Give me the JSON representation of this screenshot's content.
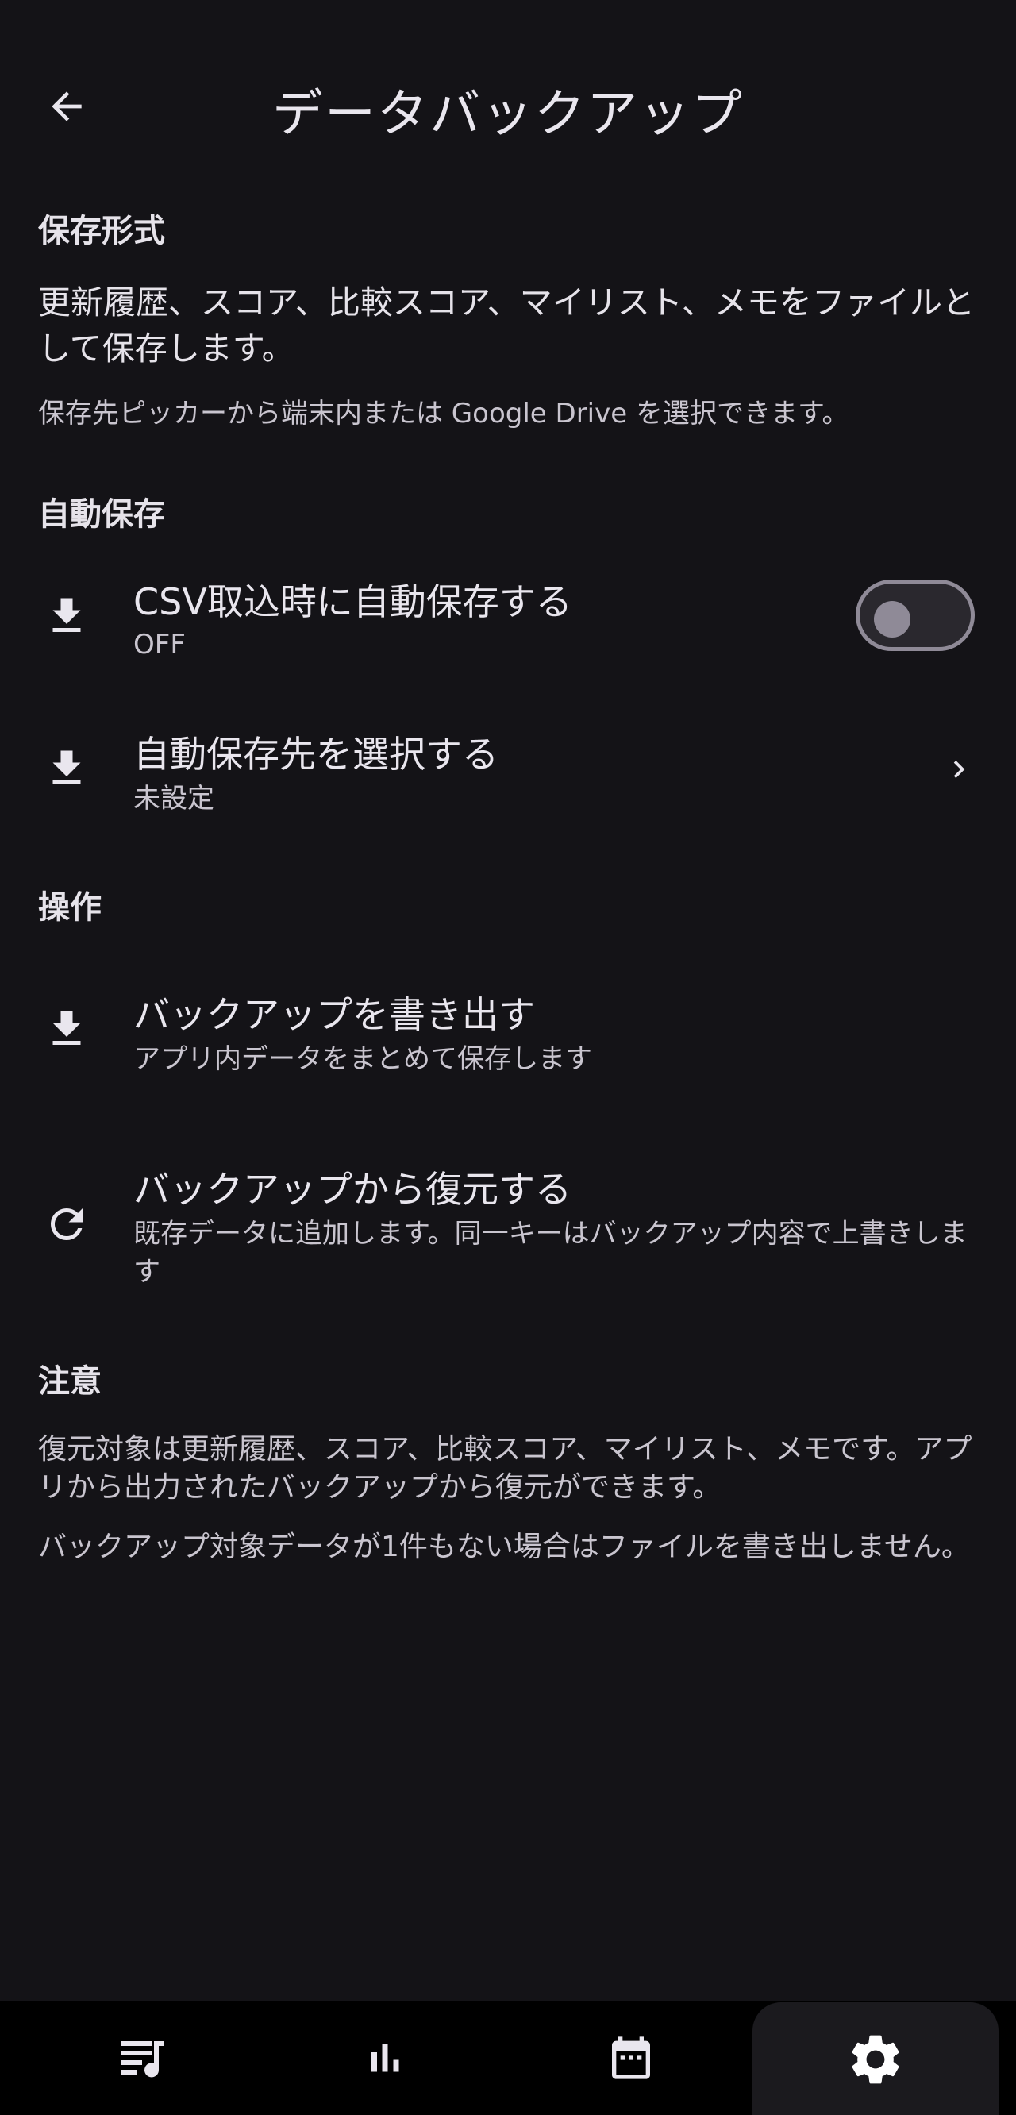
{
  "appbar": {
    "title": "データバックアップ",
    "back_icon": "arrow-back-icon"
  },
  "format_section": {
    "header": "保存形式",
    "description": "更新履歴、スコア、比較スコア、マイリスト、メモをファイルとして保存します。",
    "note": "保存先ピッカーから端末内または Google Drive を選択できます。"
  },
  "auto_section": {
    "header": "自動保存",
    "csv_auto": {
      "icon": "download-icon",
      "title": "CSV取込時に自動保存する",
      "status": "OFF",
      "enabled": false
    },
    "destination": {
      "icon": "download-icon",
      "title": "自動保存先を選択する",
      "subtitle": "未設定",
      "chevron_icon": "chevron-right-icon"
    }
  },
  "operations_section": {
    "header": "操作",
    "export": {
      "icon": "download-icon",
      "title": "バックアップを書き出す",
      "subtitle": "アプリ内データをまとめて保存します"
    },
    "restore": {
      "icon": "refresh-icon",
      "title": "バックアップから復元する",
      "subtitle": "既存データに追加します。同一キーはバックアップ内容で上書きします"
    }
  },
  "caution_section": {
    "header": "注意",
    "text1": "復元対象は更新履歴、スコア、比較スコア、マイリスト、メモです。アプリから出力されたバックアップから復元ができます。",
    "text2": "バックアップ対象データが1件もない場合はファイルを書き出しません。"
  },
  "bottom_nav": {
    "items": [
      {
        "icon": "song-list-icon",
        "active": false
      },
      {
        "icon": "bar-chart-icon",
        "active": false
      },
      {
        "icon": "calendar-icon",
        "active": false
      },
      {
        "icon": "settings-gear-icon",
        "active": true
      }
    ]
  },
  "colors": {
    "background": "#141317",
    "text": "#e6e3ea",
    "subtext": "#c9c5cf",
    "switch_outline": "#8f8a97",
    "nav_background": "#000000"
  }
}
